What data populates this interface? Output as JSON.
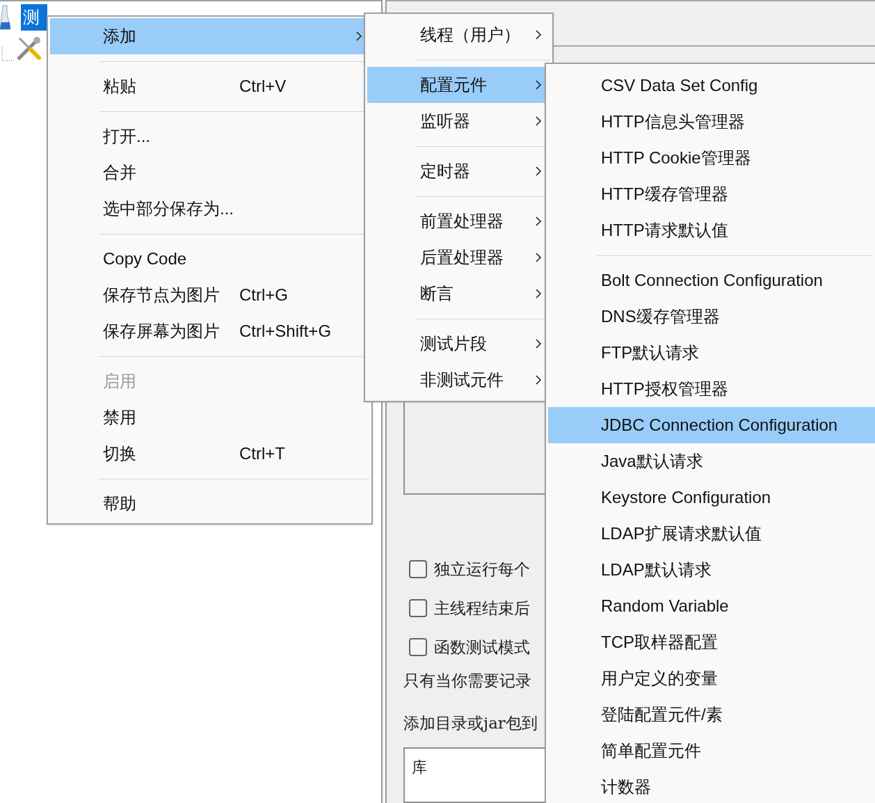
{
  "tree": {
    "items": [
      {
        "label": "测",
        "selected": true,
        "kind": "plan"
      },
      {
        "kind": "tools"
      }
    ]
  },
  "panel": {
    "checkboxes": [
      {
        "label": "独立运行每个",
        "checked": false
      },
      {
        "label": "主线程结束后",
        "checked": false
      },
      {
        "label": "函数测试模式",
        "checked": false
      }
    ],
    "note": "只有当你需要记录",
    "classpath_label": "添加目录或jar包到",
    "library_header": "库"
  },
  "menus": [
    {
      "items": [
        {
          "kind": "item",
          "label": "添加",
          "submenu": true,
          "selected": true
        },
        {
          "kind": "separator"
        },
        {
          "kind": "item",
          "label": "粘贴",
          "shortcut": "Ctrl+V",
          "selected": false
        },
        {
          "kind": "separator"
        },
        {
          "kind": "item",
          "label": "打开...",
          "selected": false
        },
        {
          "kind": "item",
          "label": "合并",
          "selected": false
        },
        {
          "kind": "item",
          "label": "选中部分保存为...",
          "selected": false
        },
        {
          "kind": "separator"
        },
        {
          "kind": "item",
          "label": "Copy Code",
          "selected": false
        },
        {
          "kind": "item",
          "label": "保存节点为图片",
          "shortcut": "Ctrl+G",
          "selected": false
        },
        {
          "kind": "item",
          "label": "保存屏幕为图片",
          "shortcut": "Ctrl+Shift+G",
          "selected": false
        },
        {
          "kind": "separator"
        },
        {
          "kind": "item",
          "label": "启用",
          "selected": false,
          "disabled": true
        },
        {
          "kind": "item",
          "label": "禁用",
          "selected": false
        },
        {
          "kind": "item",
          "label": "切换",
          "shortcut": "Ctrl+T",
          "selected": false
        },
        {
          "kind": "separator"
        },
        {
          "kind": "item",
          "label": "帮助",
          "selected": false
        }
      ]
    },
    {
      "items": [
        {
          "kind": "item",
          "label": "线程（用户）",
          "submenu": true,
          "selected": false
        },
        {
          "kind": "separator"
        },
        {
          "kind": "item",
          "label": "配置元件",
          "submenu": true,
          "selected": true
        },
        {
          "kind": "item",
          "label": "监听器",
          "submenu": true,
          "selected": false
        },
        {
          "kind": "separator"
        },
        {
          "kind": "item",
          "label": "定时器",
          "submenu": true,
          "selected": false
        },
        {
          "kind": "separator"
        },
        {
          "kind": "item",
          "label": "前置处理器",
          "submenu": true,
          "selected": false
        },
        {
          "kind": "item",
          "label": "后置处理器",
          "submenu": true,
          "selected": false
        },
        {
          "kind": "item",
          "label": "断言",
          "submenu": true,
          "selected": false
        },
        {
          "kind": "separator"
        },
        {
          "kind": "item",
          "label": "测试片段",
          "submenu": true,
          "selected": false
        },
        {
          "kind": "item",
          "label": "非测试元件",
          "submenu": true,
          "selected": false
        }
      ]
    },
    {
      "items": [
        {
          "kind": "item",
          "label": "CSV Data Set Config",
          "selected": false
        },
        {
          "kind": "item",
          "label": "HTTP信息头管理器",
          "selected": false
        },
        {
          "kind": "item",
          "label": "HTTP Cookie管理器",
          "selected": false
        },
        {
          "kind": "item",
          "label": "HTTP缓存管理器",
          "selected": false
        },
        {
          "kind": "item",
          "label": "HTTP请求默认值",
          "selected": false
        },
        {
          "kind": "separator"
        },
        {
          "kind": "item",
          "label": "Bolt Connection Configuration",
          "selected": false
        },
        {
          "kind": "item",
          "label": "DNS缓存管理器",
          "selected": false
        },
        {
          "kind": "item",
          "label": "FTP默认请求",
          "selected": false
        },
        {
          "kind": "item",
          "label": "HTTP授权管理器",
          "selected": false
        },
        {
          "kind": "item",
          "label": "JDBC Connection Configuration",
          "selected": true
        },
        {
          "kind": "item",
          "label": "Java默认请求",
          "selected": false
        },
        {
          "kind": "item",
          "label": "Keystore Configuration",
          "selected": false
        },
        {
          "kind": "item",
          "label": "LDAP扩展请求默认值",
          "selected": false
        },
        {
          "kind": "item",
          "label": "LDAP默认请求",
          "selected": false
        },
        {
          "kind": "item",
          "label": "Random Variable",
          "selected": false
        },
        {
          "kind": "item",
          "label": "TCP取样器配置",
          "selected": false
        },
        {
          "kind": "item",
          "label": "用户定义的变量",
          "selected": false
        },
        {
          "kind": "item",
          "label": "登陆配置元件/素",
          "selected": false
        },
        {
          "kind": "item",
          "label": "简单配置元件",
          "selected": false
        },
        {
          "kind": "item",
          "label": "计数器",
          "selected": false
        }
      ]
    }
  ]
}
